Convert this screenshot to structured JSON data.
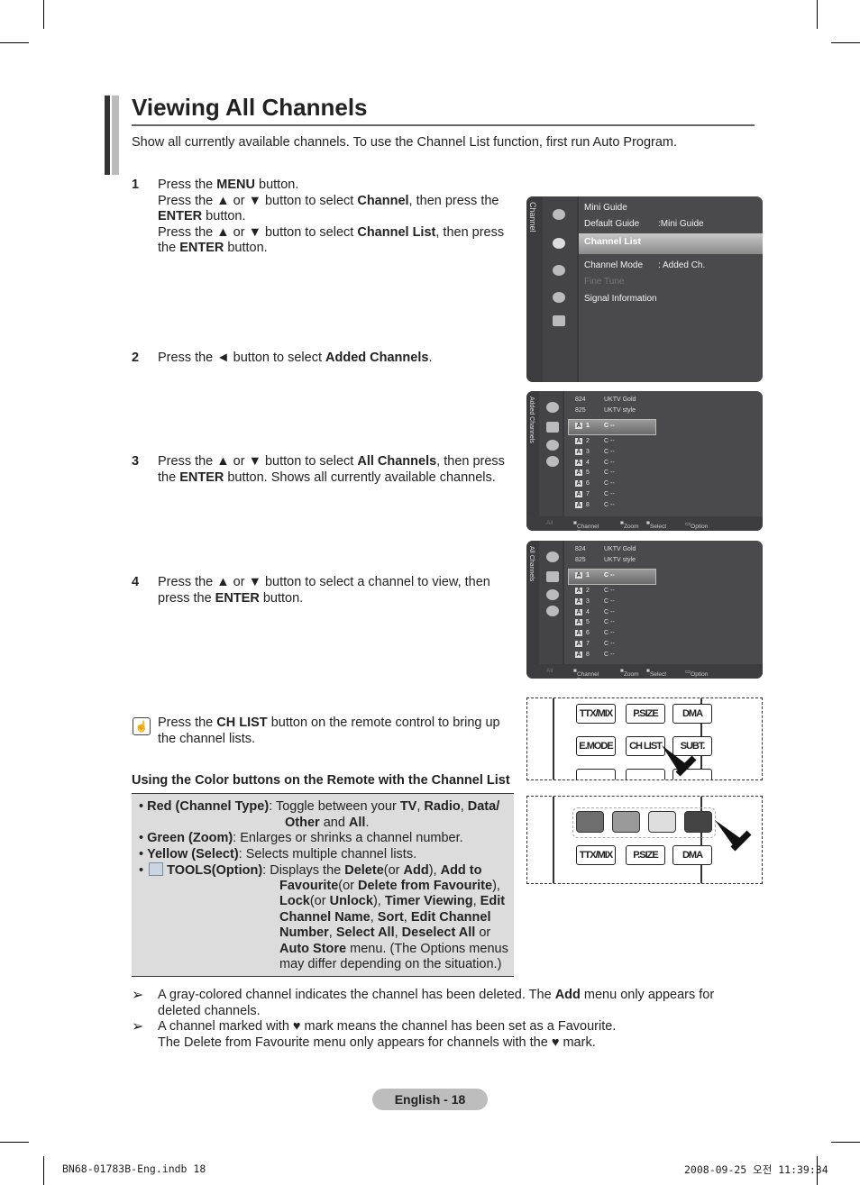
{
  "title": "Viewing All Channels",
  "intro": "Show all currently available channels. To use the Channel List function, first run Auto Program.",
  "steps": [
    {
      "num": "1",
      "segs": [
        [
          "Press the ",
          0
        ],
        [
          "MENU",
          1
        ],
        [
          " button.\nPress the ▲ or ▼ button to select ",
          0
        ],
        [
          "Channel",
          1
        ],
        [
          ", then press the ",
          0
        ],
        [
          "ENTER",
          1
        ],
        [
          " button.\nPress the ▲ or ▼ button to select ",
          0
        ],
        [
          "Channel List",
          1
        ],
        [
          ", then press the ",
          0
        ],
        [
          "ENTER",
          1
        ],
        [
          " button.",
          0
        ]
      ]
    },
    {
      "num": "2",
      "segs": [
        [
          "Press the ◄ button to select ",
          0
        ],
        [
          "Added Channels",
          1
        ],
        [
          ".",
          0
        ]
      ]
    },
    {
      "num": "3",
      "segs": [
        [
          "Press the ▲ or ▼ button to select ",
          0
        ],
        [
          "All Channels",
          1
        ],
        [
          ", then press the ",
          0
        ],
        [
          "ENTER",
          1
        ],
        [
          " button. Shows all currently available channels.",
          0
        ]
      ]
    },
    {
      "num": "4",
      "segs": [
        [
          "Press the ▲ or ▼ button to select a channel to view, then press the ",
          0
        ],
        [
          "ENTER",
          1
        ],
        [
          " button.",
          0
        ]
      ]
    }
  ],
  "osd_menu": {
    "side_label": "Channel",
    "items": [
      {
        "label": "Mini Guide",
        "value": ""
      },
      {
        "label": "Default Guide",
        "value": ":Mini Guide"
      },
      {
        "label": "Channel List",
        "value": "",
        "selected": true
      },
      {
        "label": "Channel Mode",
        "value": ": Added Ch."
      },
      {
        "label": "Fine Tune",
        "value": "",
        "disabled": true
      },
      {
        "label": "Signal Information",
        "value": ""
      }
    ]
  },
  "channel_lists": [
    {
      "side_label": "Added Channels"
    },
    {
      "side_label": "All Channels"
    }
  ],
  "channel_rows": {
    "top": [
      {
        "num": "824",
        "name": "UKTV Gold"
      },
      {
        "num": "825",
        "name": "UKTV style"
      }
    ],
    "list": [
      {
        "type": "A",
        "num": "1",
        "name": "C --"
      },
      {
        "type": "A",
        "num": "2",
        "name": "C --"
      },
      {
        "type": "A",
        "num": "3",
        "name": "C --"
      },
      {
        "type": "A",
        "num": "4",
        "name": "C --"
      },
      {
        "type": "A",
        "num": "5",
        "name": "C --"
      },
      {
        "type": "A",
        "num": "6",
        "name": "C --"
      },
      {
        "type": "A",
        "num": "7",
        "name": "C --"
      },
      {
        "type": "A",
        "num": "8",
        "name": "C --"
      }
    ],
    "footer": {
      "mode": "All",
      "red": "Channel Type",
      "green": "Zoom",
      "yellow": "Select",
      "tools": "Option"
    }
  },
  "remote1": {
    "buttons": [
      "TTX/MIX",
      "P.SIZE",
      "DMA",
      "E.MODE",
      "CH LIST",
      "SUBT."
    ]
  },
  "remote2": {
    "buttons": [
      "TTX/MIX",
      "P.SIZE",
      "DMA"
    ],
    "colors": [
      "#6e6e6e",
      "#9a9a9a",
      "#dedede",
      "#444444"
    ]
  },
  "chlist_note": {
    "segs": [
      [
        "Press the ",
        0
      ],
      [
        "CH LIST",
        1
      ],
      [
        " button on the remote control to bring up the channel lists.",
        0
      ]
    ]
  },
  "color_heading": "Using the Color buttons on the Remote with the Channel List",
  "color_items": [
    {
      "head": "Red (Channel Type)",
      "lines": [
        [
          [
            "Toggle between your ",
            0
          ],
          [
            "TV",
            1
          ],
          [
            ", ",
            0
          ],
          [
            "Radio",
            1
          ],
          [
            ", ",
            0
          ],
          [
            "Data/",
            1
          ]
        ],
        [
          [
            "Other",
            1
          ],
          [
            " and ",
            0
          ],
          [
            "All",
            1
          ],
          [
            ".",
            0
          ]
        ]
      ]
    },
    {
      "head": "Green (Zoom)",
      "lines": [
        [
          [
            "Enlarges or shrinks a channel number.",
            0
          ]
        ]
      ]
    },
    {
      "head": "Yellow (Select)",
      "lines": [
        [
          [
            "Selects multiple channel lists.",
            0
          ]
        ]
      ]
    },
    {
      "head": "TOOLS(Option)",
      "icon": "tools-icon",
      "lines": [
        [
          [
            "Displays the ",
            0
          ],
          [
            "Delete",
            1
          ],
          [
            "(or ",
            0
          ],
          [
            "Add",
            1
          ],
          [
            "), ",
            0
          ],
          [
            "Add to",
            1
          ]
        ],
        [
          [
            "Favourite",
            1
          ],
          [
            "(or ",
            0
          ],
          [
            "Delete from Favourite",
            1
          ],
          [
            "),",
            0
          ]
        ],
        [
          [
            "Lock",
            1
          ],
          [
            "(or ",
            0
          ],
          [
            "Unlock",
            1
          ],
          [
            "), ",
            0
          ],
          [
            "Timer Viewing",
            1
          ],
          [
            ", ",
            0
          ],
          [
            "Edit",
            1
          ]
        ],
        [
          [
            "Channel Name",
            1
          ],
          [
            ", ",
            0
          ],
          [
            "Sort",
            1
          ],
          [
            ", ",
            0
          ],
          [
            "Edit Channel",
            1
          ]
        ],
        [
          [
            "Number",
            1
          ],
          [
            ", ",
            0
          ],
          [
            "Select All",
            1
          ],
          [
            ", ",
            0
          ],
          [
            "Deselect All",
            1
          ],
          [
            " or",
            0
          ]
        ],
        [
          [
            "Auto Store",
            1
          ],
          [
            " menu. (The Options menus",
            0
          ]
        ],
        [
          [
            "may differ depending on the situation.)",
            0
          ]
        ]
      ]
    }
  ],
  "notes": [
    {
      "segs": [
        [
          "A gray-colored channel indicates the channel has been deleted. The ",
          0
        ],
        [
          "Add",
          1
        ],
        [
          " menu only appears for\ndeleted channels.",
          0
        ]
      ]
    },
    {
      "segs": [
        [
          "A channel marked with ♥ mark means the channel has been set as a Favourite.\nThe Delete from Favourite menu only appears for channels with the ♥ mark.",
          0
        ]
      ]
    }
  ],
  "page_label": "English - 18",
  "slug_left": "BN68-01783B-Eng.indb   18",
  "slug_right": "2008-09-25   오전 11:39:34"
}
